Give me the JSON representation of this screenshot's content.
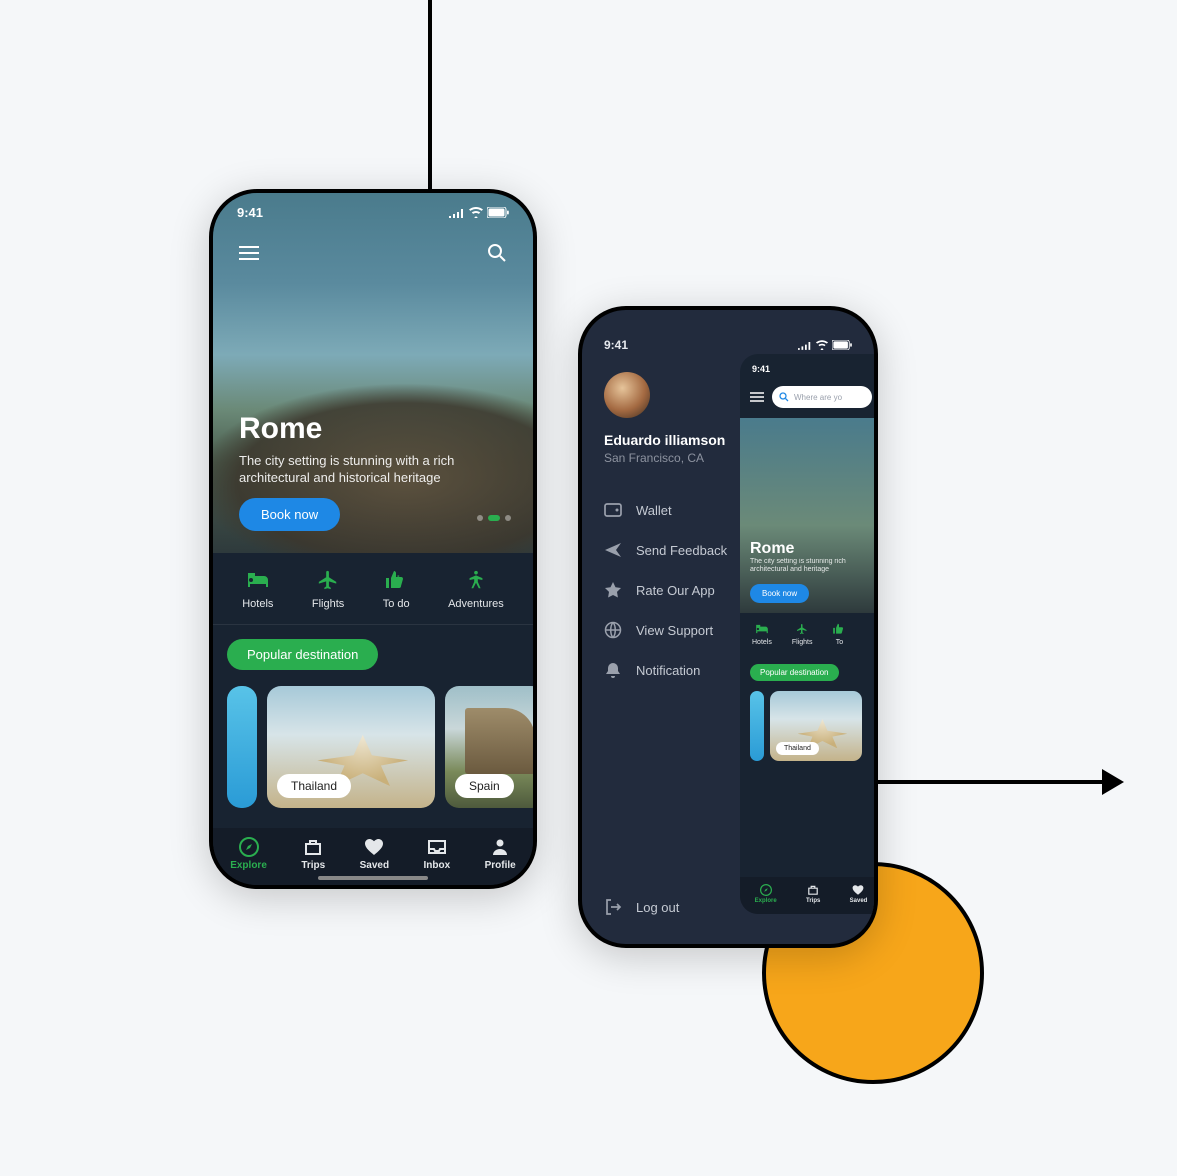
{
  "statusTime": "9:41",
  "hero": {
    "title": "Rome",
    "subtitle": "The city setting is stunning with a rich architectural and historical heritage",
    "cta": "Book now"
  },
  "categories": [
    {
      "label": "Hotels"
    },
    {
      "label": "Flights"
    },
    {
      "label": "To do"
    },
    {
      "label": "Adventures"
    }
  ],
  "popular": {
    "heading": "Popular destination",
    "cards": [
      {
        "label": "Thailand"
      },
      {
        "label": "Spain"
      }
    ]
  },
  "tabs": [
    {
      "label": "Explore"
    },
    {
      "label": "Trips"
    },
    {
      "label": "Saved"
    },
    {
      "label": "Inbox"
    },
    {
      "label": "Profile"
    }
  ],
  "drawer": {
    "user": {
      "name": "Eduardo illiamson",
      "location": "San Francisco, CA"
    },
    "items": [
      {
        "label": "Wallet"
      },
      {
        "label": "Send Feedback"
      },
      {
        "label": "Rate Our App"
      },
      {
        "label": "View Support"
      },
      {
        "label": "Notification"
      }
    ],
    "logout": "Log out"
  },
  "mini": {
    "searchPlaceholder": "Where are yo",
    "hero": {
      "title": "Rome",
      "subtitle": "The city setting is stunning rich architectural and heritage",
      "cta": "Book now"
    },
    "categories": [
      {
        "label": "Hotels"
      },
      {
        "label": "Flights"
      },
      {
        "label": "To"
      }
    ],
    "popularHeading": "Popular destination",
    "card": "Thailand",
    "tabs": [
      {
        "label": "Explore"
      },
      {
        "label": "Trips"
      },
      {
        "label": "Saved"
      }
    ]
  }
}
